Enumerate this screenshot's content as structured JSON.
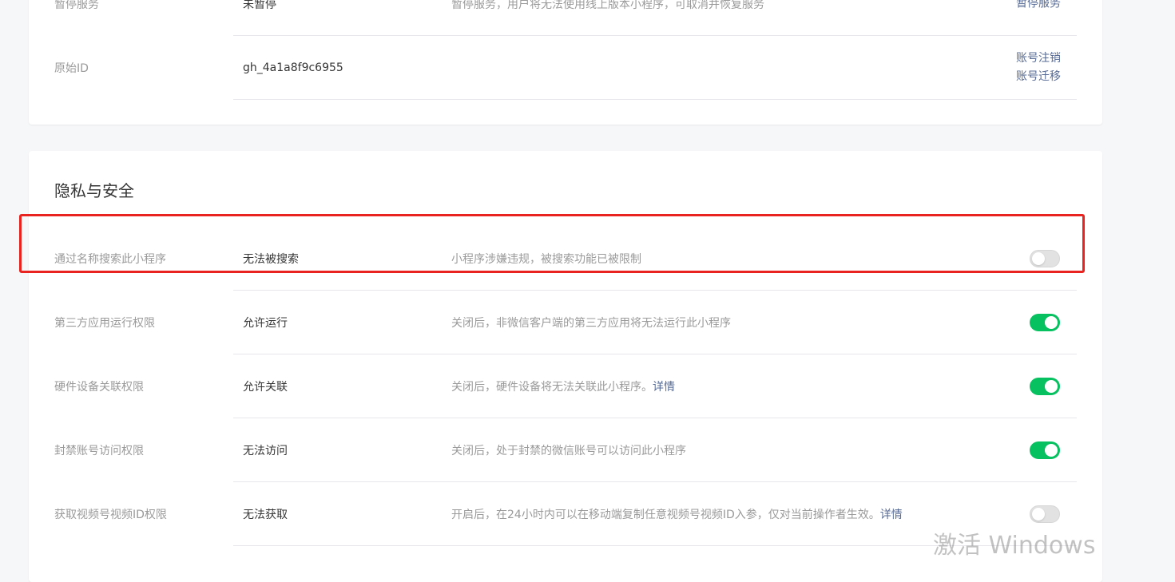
{
  "account_card": {
    "rows": [
      {
        "label": "暂停服务",
        "value": "未暂停",
        "description": "暂停服务，用户将无法使用线上版本小程序，可取消并恢复服务",
        "actions": [
          "暂停服务"
        ]
      },
      {
        "label": "原始ID",
        "value": "gh_4a1a8f9c6955",
        "description": "",
        "actions": [
          "账号注销",
          "账号迁移"
        ]
      }
    ]
  },
  "privacy_card": {
    "title": "隐私与安全",
    "rows": [
      {
        "label": "通过名称搜索此小程序",
        "value": "无法被搜索",
        "description": "小程序涉嫌违规，被搜索功能已被限制",
        "toggle": "off"
      },
      {
        "label": "第三方应用运行权限",
        "value": "允许运行",
        "description": "关闭后，非微信客户端的第三方应用将无法运行此小程序",
        "toggle": "on"
      },
      {
        "label": "硬件设备关联权限",
        "value": "允许关联",
        "description": "关闭后，硬件设备将无法关联此小程序。",
        "link": "详情",
        "toggle": "on"
      },
      {
        "label": "封禁账号访问权限",
        "value": "无法访问",
        "description": "关闭后，处于封禁的微信账号可以访问此小程序",
        "toggle": "on"
      },
      {
        "label": "获取视频号视频ID权限",
        "value": "无法获取",
        "description": "开启后，在24小时内可以在移动端复制任意视频号视频ID入参，仅对当前操作者生效。",
        "link": "详情",
        "toggle": "off"
      }
    ]
  },
  "watermark": "激活 Windows",
  "colors": {
    "toggle_on": "#07c160",
    "toggle_off": "#e2e2e2",
    "link": "#576b95",
    "highlight": "#e9231f"
  }
}
